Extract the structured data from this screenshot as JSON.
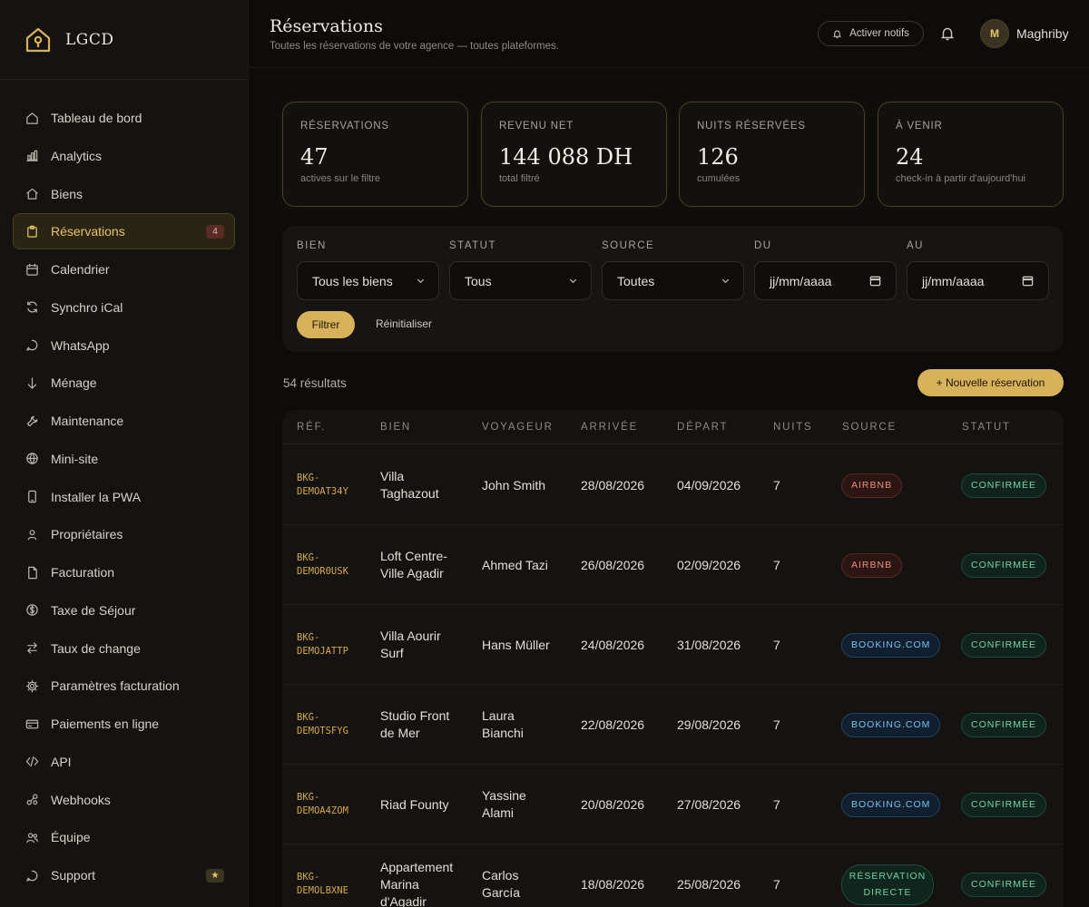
{
  "brand": {
    "name": "LGCD"
  },
  "sidebar": {
    "items": [
      {
        "label": "Tableau de bord",
        "icon": "home-icon"
      },
      {
        "label": "Analytics",
        "icon": "bar-chart-icon"
      },
      {
        "label": "Biens",
        "icon": "house-icon"
      },
      {
        "label": "Réservations",
        "icon": "clipboard-icon",
        "badge": "4",
        "active": true
      },
      {
        "label": "Calendrier",
        "icon": "calendar-icon"
      },
      {
        "label": "Synchro iCal",
        "icon": "refresh-icon"
      },
      {
        "label": "WhatsApp",
        "icon": "chat-bubble-icon"
      },
      {
        "label": "Ménage",
        "icon": "arrow-down-icon"
      },
      {
        "label": "Maintenance",
        "icon": "wrench-icon"
      },
      {
        "label": "Mini-site",
        "icon": "globe-icon"
      },
      {
        "label": "Installer la PWA",
        "icon": "phone-icon"
      },
      {
        "label": "Propriétaires",
        "icon": "person-icon"
      },
      {
        "label": "Facturation",
        "icon": "document-icon"
      },
      {
        "label": "Taxe de Séjour",
        "icon": "dollar-circle-icon"
      },
      {
        "label": "Taux de change",
        "icon": "swap-arrows-icon"
      },
      {
        "label": "Paramètres facturation",
        "icon": "gear-icon"
      },
      {
        "label": "Paiements en ligne",
        "icon": "credit-card-icon"
      },
      {
        "label": "API",
        "icon": "code-icon"
      },
      {
        "label": "Webhooks",
        "icon": "link-icon"
      },
      {
        "label": "Équipe",
        "icon": "people-icon"
      },
      {
        "label": "Support",
        "icon": "chat-bubble-icon",
        "badge": "★"
      }
    ]
  },
  "header": {
    "title": "Réservations",
    "subtitle": "Toutes les réservations de votre agence — toutes plateformes.",
    "notif_label": "Activer notifs",
    "avatar_initial": "M",
    "username": "Maghriby"
  },
  "stats": [
    {
      "label": "RÉSERVATIONS",
      "value": "47",
      "sub": "actives sur le filtre"
    },
    {
      "label": "REVENU NET",
      "value": "144 088 DH",
      "sub": "total filtré"
    },
    {
      "label": "NUITS RÉSERVÉES",
      "value": "126",
      "sub": "cumulées"
    },
    {
      "label": "À VENIR",
      "value": "24",
      "sub": "check-in à partir d'aujourd'hui"
    }
  ],
  "filters": {
    "bien": {
      "label": "BIEN",
      "value": "Tous les biens"
    },
    "statut": {
      "label": "STATUT",
      "value": "Tous"
    },
    "source": {
      "label": "SOURCE",
      "value": "Toutes"
    },
    "du": {
      "label": "DU",
      "value": "jj/mm/aaaa"
    },
    "au": {
      "label": "AU",
      "value": "jj/mm/aaaa"
    },
    "filter_button": "Filtrer",
    "reset_button": "Réinitialiser"
  },
  "results_count": "54 résultats",
  "new_button": "+ Nouvelle réservation",
  "table": {
    "columns": [
      "RÉF.",
      "BIEN",
      "VOYAGEUR",
      "ARRIVÉE",
      "DÉPART",
      "NUITS",
      "SOURCE",
      "STATUT"
    ],
    "rows": [
      {
        "ref": [
          "BKG-",
          "DEMOAT34Y"
        ],
        "bien": [
          "Villa",
          "Taghazout"
        ],
        "voyageur": [
          "John Smith"
        ],
        "arrivee": "28/08/2026",
        "depart": "04/09/2026",
        "nuits": "7",
        "source": "AIRBNB",
        "source_type": "airbnb",
        "statut": "CONFIRMÉE"
      },
      {
        "ref": [
          "BKG-",
          "DEMOR0USK"
        ],
        "bien": [
          "Loft Centre-",
          "Ville Agadir"
        ],
        "voyageur": [
          "Ahmed Tazi"
        ],
        "arrivee": "26/08/2026",
        "depart": "02/09/2026",
        "nuits": "7",
        "source": "AIRBNB",
        "source_type": "airbnb",
        "statut": "CONFIRMÉE"
      },
      {
        "ref": [
          "BKG-",
          "DEMOJATTP"
        ],
        "bien": [
          "Villa Aourir",
          "Surf"
        ],
        "voyageur": [
          "Hans Müller"
        ],
        "arrivee": "24/08/2026",
        "depart": "31/08/2026",
        "nuits": "7",
        "source": "BOOKING.COM",
        "source_type": "booking",
        "statut": "CONFIRMÉE"
      },
      {
        "ref": [
          "BKG-",
          "DEMOTSFYG"
        ],
        "bien": [
          "Studio Front",
          "de Mer"
        ],
        "voyageur": [
          "Laura",
          "Bianchi"
        ],
        "arrivee": "22/08/2026",
        "depart": "29/08/2026",
        "nuits": "7",
        "source": "BOOKING.COM",
        "source_type": "booking",
        "statut": "CONFIRMÉE"
      },
      {
        "ref": [
          "BKG-",
          "DEMOA4ZOM"
        ],
        "bien": [
          "Riad Founty"
        ],
        "voyageur": [
          "Yassine",
          "Alami"
        ],
        "arrivee": "20/08/2026",
        "depart": "27/08/2026",
        "nuits": "7",
        "source": "BOOKING.COM",
        "source_type": "booking",
        "statut": "CONFIRMÉE"
      },
      {
        "ref": [
          "BKG-",
          "DEMOLBXNE"
        ],
        "bien": [
          "Appartement",
          "Marina",
          "d'Agadir"
        ],
        "voyageur": [
          "Carlos",
          "García"
        ],
        "arrivee": "18/08/2026",
        "depart": "25/08/2026",
        "nuits": "7",
        "source": "RÉSERVATION DIRECTE",
        "source_type": "direct",
        "statut": "CONFIRMÉE"
      }
    ]
  },
  "colors": {
    "accent": "#d8b25a",
    "background": "#0d0c0b",
    "sidebar": "#141311",
    "airbnb": "#ee8d80",
    "booking": "#7ec0ee",
    "direct": "#6fd3a3",
    "confirmed": "#79d5a8"
  }
}
